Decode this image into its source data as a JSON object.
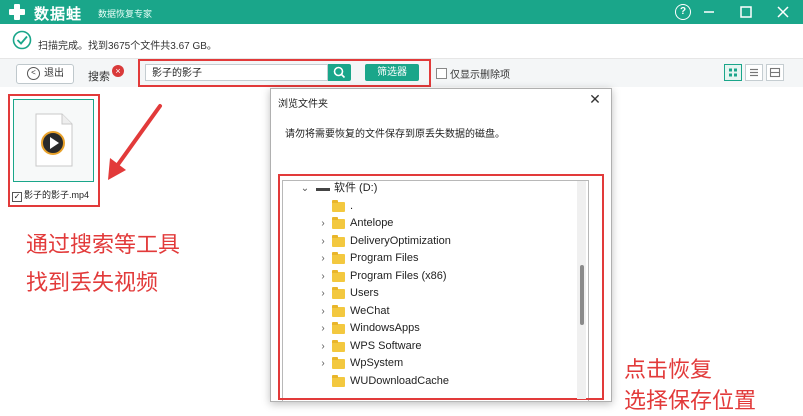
{
  "titlebar": {
    "app_name": "数据蛙",
    "app_subtitle": "数据恢复专家",
    "help_icon": "question-mark",
    "minimize_icon": "minimize",
    "maximize_icon": "maximize",
    "close_icon": "close",
    "color": "#1aa68a"
  },
  "status": {
    "icon": "check-circle",
    "text": "扫描完成。找到3675个文件共3.67 GB。"
  },
  "toolbar": {
    "back_label": "退出",
    "search_label": "搜索",
    "search_value": "影子的影子",
    "filter_label": "筛选器",
    "only_deleted_label": "仅显示删除项",
    "views": [
      "grid-view",
      "list-view",
      "detail-view"
    ]
  },
  "file": {
    "name": "影子的影子.mp4",
    "checked": true
  },
  "annotations": {
    "left_line1": "通过搜索等工具",
    "left_line2": "找到丢失视频",
    "right_line1": "点击恢复",
    "right_line2": "选择保存位置",
    "color": "#e23a3a"
  },
  "dialog": {
    "title": "浏览文件夹",
    "message": "请勿将需要恢复的文件保存到原丢失数据的磁盘。",
    "tree": {
      "drive": "软件 (D:)",
      "folders": [
        {
          "name": ".",
          "expandable": false
        },
        {
          "name": "Antelope",
          "expandable": true
        },
        {
          "name": "DeliveryOptimization",
          "expandable": true
        },
        {
          "name": "Program Files",
          "expandable": true
        },
        {
          "name": "Program Files (x86)",
          "expandable": true
        },
        {
          "name": "Users",
          "expandable": true
        },
        {
          "name": "WeChat",
          "expandable": true
        },
        {
          "name": "WindowsApps",
          "expandable": true
        },
        {
          "name": "WPS Software",
          "expandable": true
        },
        {
          "name": "WpSystem",
          "expandable": true
        },
        {
          "name": "WUDownloadCache",
          "expandable": false
        }
      ]
    }
  }
}
